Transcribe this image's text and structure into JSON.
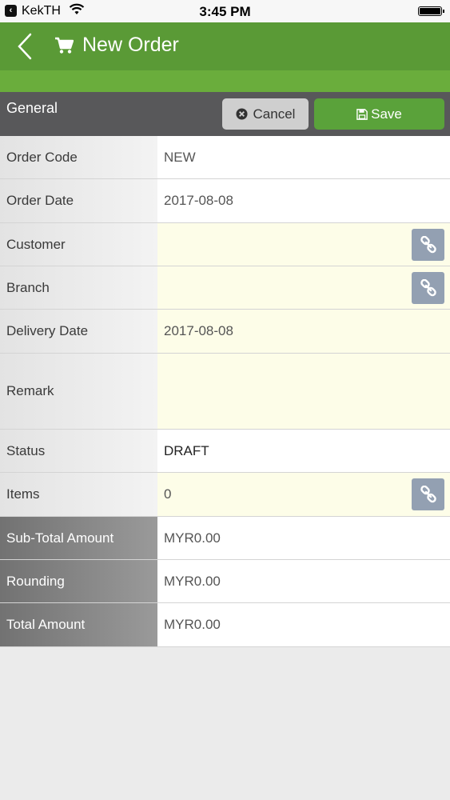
{
  "status_bar": {
    "carrier": "KekTH",
    "time": "3:45 PM"
  },
  "header": {
    "title": "New Order"
  },
  "toolbar": {
    "section_title": "General",
    "cancel_label": "Cancel",
    "save_label": "Save"
  },
  "form": {
    "order_code": {
      "label": "Order Code",
      "value": "NEW"
    },
    "order_date": {
      "label": "Order Date",
      "value": "2017-08-08"
    },
    "customer": {
      "label": "Customer",
      "value": ""
    },
    "branch": {
      "label": "Branch",
      "value": ""
    },
    "delivery_date": {
      "label": "Delivery Date",
      "value": "2017-08-08"
    },
    "remark": {
      "label": "Remark",
      "value": ""
    },
    "status": {
      "label": "Status",
      "value": "DRAFT"
    },
    "items": {
      "label": "Items",
      "value": "0"
    },
    "sub_total": {
      "label": "Sub-Total Amount",
      "value": "MYR0.00"
    },
    "rounding": {
      "label": "Rounding",
      "value": "MYR0.00"
    },
    "total": {
      "label": "Total Amount",
      "value": "MYR0.00"
    }
  },
  "colors": {
    "header_green": "#5a9a36",
    "save_green": "#5aa23a",
    "toolbar_gray": "#58585a",
    "editable_field": "#fdfde8",
    "link_button": "#93a0b2"
  },
  "icons": {
    "back": "chevron-left-icon",
    "cart": "cart-icon",
    "cancel": "times-circle-icon",
    "save": "floppy-disk-icon",
    "link": "chain-link-icon"
  }
}
